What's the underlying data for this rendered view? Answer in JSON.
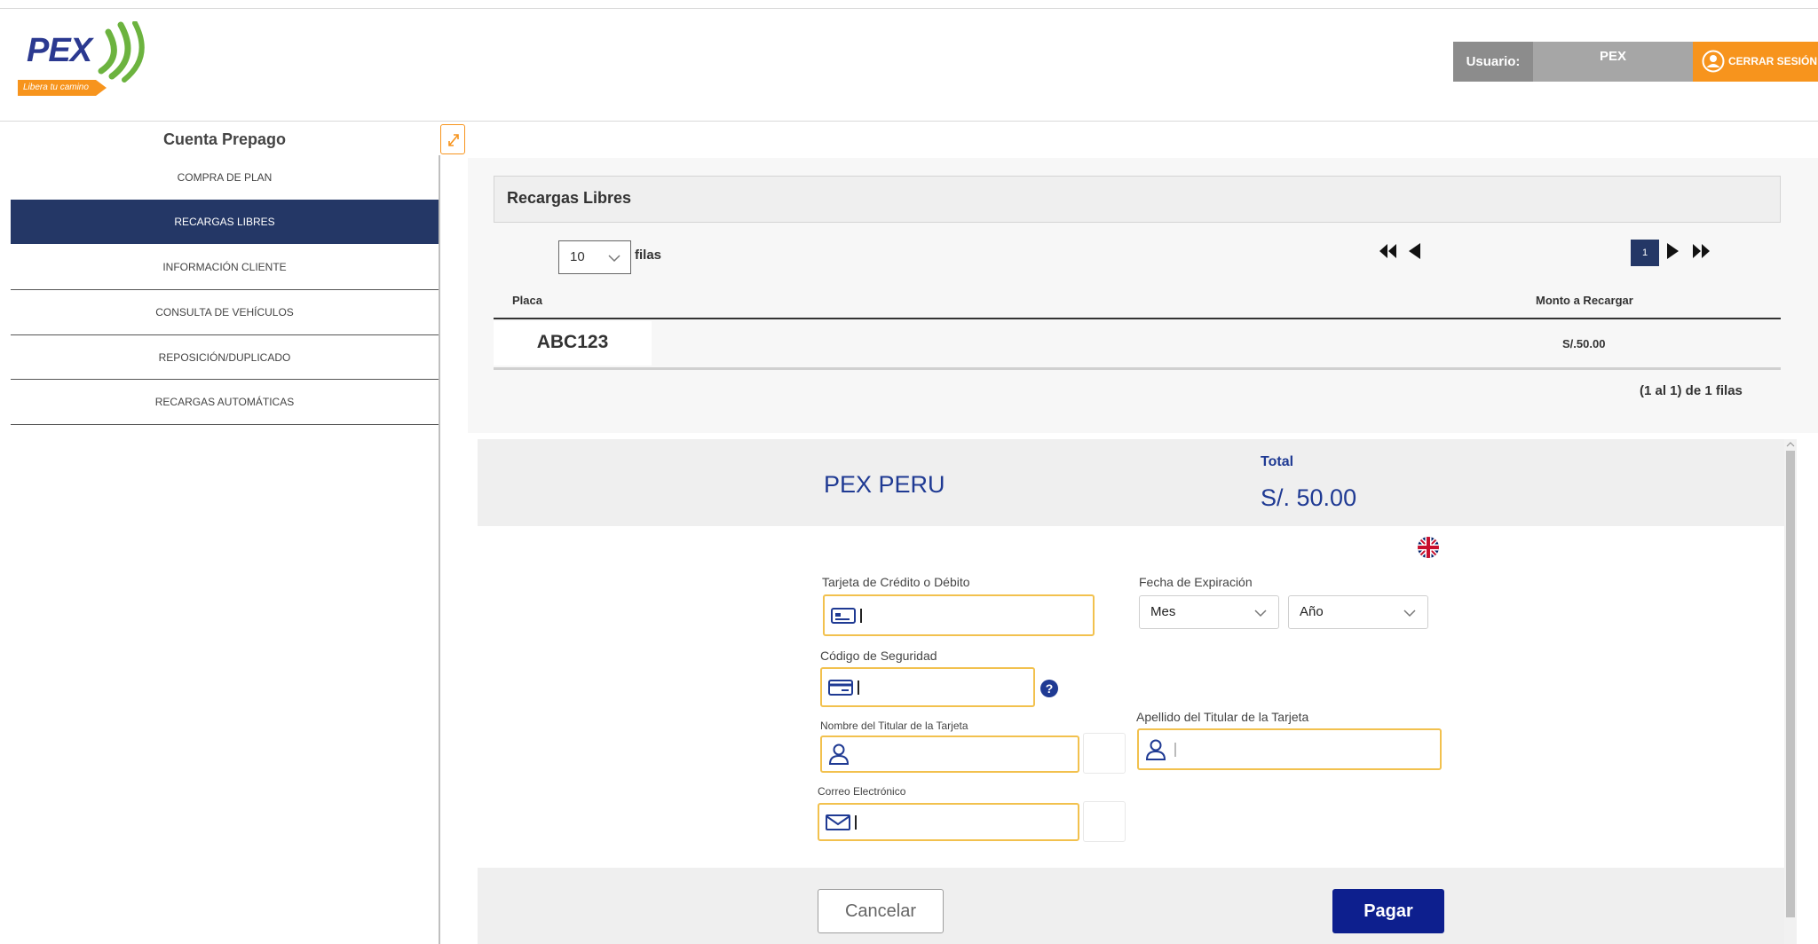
{
  "header": {
    "logo_text": "PEX",
    "logo_tagline": "Libera tu camino",
    "user_label": "Usuario:",
    "user_name": "PEX",
    "logout_label": "CERRAR SESIÓN"
  },
  "sidebar": {
    "title": "Cuenta Prepago",
    "items": [
      {
        "label": "COMPRA DE PLAN"
      },
      {
        "label": "RECARGAS LIBRES"
      },
      {
        "label": "INFORMACIÓN CLIENTE"
      },
      {
        "label": "CONSULTA DE VEHÍCULOS"
      },
      {
        "label": "REPOSICIÓN/DUPLICADO"
      },
      {
        "label": "RECARGAS AUTOMÁTICAS"
      }
    ],
    "active_index": 1
  },
  "recargas": {
    "panel_title": "Recargas Libres",
    "rows_per_page": "10",
    "rows_label": "filas",
    "current_page": "1",
    "columns": [
      "Placa",
      "Monto a Recargar"
    ],
    "rows": [
      {
        "placa": "ABC123",
        "monto": "S/.50.00"
      }
    ],
    "summary": "(1 al 1) de 1 filas"
  },
  "payment": {
    "merchant": "PEX PERU",
    "total_label": "Total",
    "total_value": "S/. 50.00",
    "card_label": "Tarjeta de Crédito o Débito",
    "expiry_label": "Fecha de Expiración",
    "month_value": "Mes",
    "year_value": "Año",
    "cvv_label": "Código de Seguridad",
    "help_glyph": "?",
    "first_name_label": "Nombre del Titular de la Tarjeta",
    "last_name_label": "Apellido del Titular de la Tarjeta",
    "email_label": "Correo Electrónico",
    "cancel_label": "Cancelar",
    "pay_label": "Pagar"
  },
  "colors": {
    "brand_blue": "#243766",
    "brand_orange": "#f7941d",
    "pay_button": "#0d1f8e",
    "field_border": "#f2c14e"
  }
}
